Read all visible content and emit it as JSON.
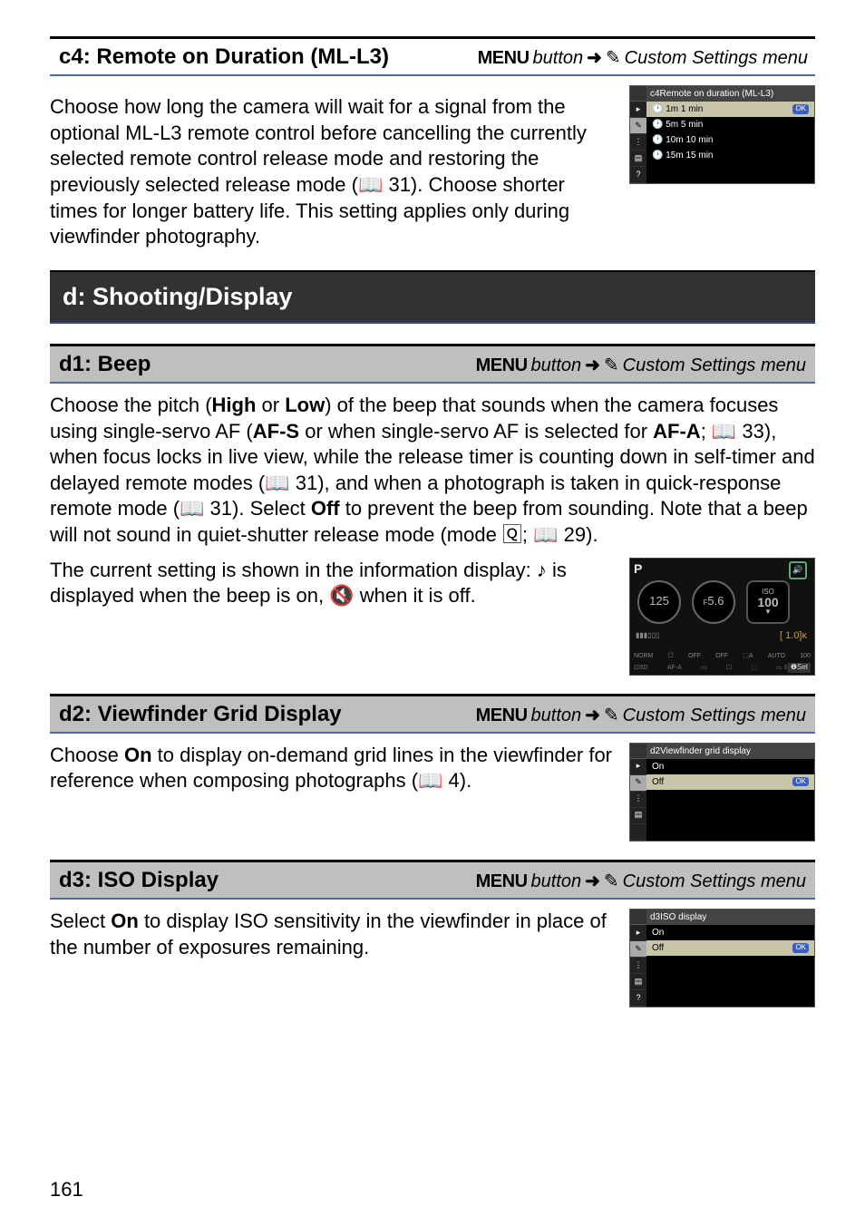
{
  "c4": {
    "title": "c4: Remote on Duration (ML-L3)",
    "menu_button": "MENU",
    "button_word": "button",
    "menu_target": "Custom Settings menu",
    "body": "Choose how long the camera will wait for a signal from the optional ML-L3 remote control before cancelling the currently selected remote control release mode and restoring the previously selected release mode (📖 31).  Choose shorter times for longer battery life.  This setting applies only during viewfinder photography.",
    "lcd_title": "c4Remote on duration (ML-L3)",
    "options": [
      {
        "icon": "🕐 1m",
        "label": "1 min",
        "selected": true
      },
      {
        "icon": "🕐 5m",
        "label": "5 min"
      },
      {
        "icon": "🕐 10m",
        "label": "10 min"
      },
      {
        "icon": "🕐 15m",
        "label": "15 min"
      }
    ]
  },
  "major": {
    "title": "d: Shooting/Display"
  },
  "d1": {
    "title": "d1: Beep",
    "menu_button": "MENU",
    "button_word": "button",
    "menu_target": "Custom Settings menu",
    "body1": "Choose the pitch (High or Low) of the beep that sounds when the camera focuses using single-servo AF (AF-S or when single-servo AF is selected for AF-A; 📖 33), when focus locks in live view, while the release timer is counting down in self-timer and delayed remote modes (📖 31), and when a photograph is taken in quick-response remote mode (📖 31).  Select Off to prevent the beep from sounding.  Note that a beep will not sound in quiet-shutter release mode (mode 🅀; 📖 29).",
    "body2_a": "The current setting is shown in the information display: ",
    "body2_b": " is displayed when the beep is on, ",
    "body2_c": " when it is off.",
    "info": {
      "shutter": "125",
      "aperture": "5.6",
      "iso_l": "ISO",
      "iso": "100",
      "exp": "[  1.0]ᴋ",
      "row1": [
        "NORM",
        "☐",
        "OFF",
        "OFF",
        "⬚A",
        "AUTO",
        "100"
      ],
      "row2": [
        "⊡SD",
        "AF-A",
        "▭",
        "☐",
        "⬚",
        "▭ 0.0 ⊡ 0.0"
      ],
      "set": "❶Set",
      "p": "P"
    }
  },
  "d2": {
    "title": "d2: Viewfinder Grid Display",
    "menu_button": "MENU",
    "button_word": "button",
    "menu_target": "Custom Settings menu",
    "body": "Choose On to display on-demand grid lines in the viewfinder for reference when composing photographs (📖 4).",
    "lcd_title": "d2Viewfinder grid display",
    "options": [
      {
        "label": "On"
      },
      {
        "label": "Off",
        "selected": true
      }
    ]
  },
  "d3": {
    "title": "d3: ISO Display",
    "menu_button": "MENU",
    "button_word": "button",
    "menu_target": "Custom Settings menu",
    "body": "Select On to display ISO sensitivity in the viewfinder in place of the number of exposures remaining.",
    "lcd_title": "d3ISO display",
    "options": [
      {
        "label": "On"
      },
      {
        "label": "Off",
        "selected": true
      }
    ]
  },
  "page": "161",
  "ok_label": "OK"
}
